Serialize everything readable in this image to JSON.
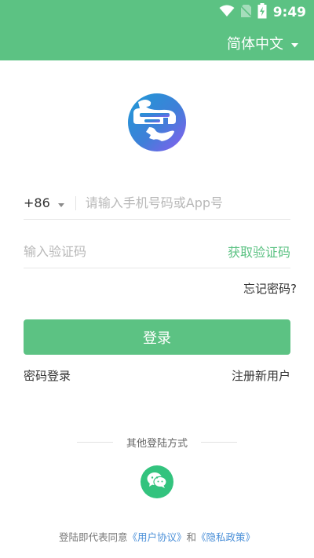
{
  "status_bar": {
    "time": "9:49",
    "icons": [
      "wifi-icon",
      "no-sim-icon",
      "battery-charging-icon"
    ]
  },
  "header": {
    "language_label": "简体中文",
    "dropdown_icon": "caret-down-icon",
    "background_color": "#5cc283"
  },
  "logo": {
    "icon": "app-logo-icon"
  },
  "phone": {
    "country_code": "+86",
    "placeholder": "请输入手机号码或App号",
    "value": ""
  },
  "code": {
    "placeholder": "输入验证码",
    "value": "",
    "get_code_label": "获取验证码"
  },
  "forgot_password": "忘记密码?",
  "login_button": "登录",
  "password_login": "密码登录",
  "register": "注册新用户",
  "other_login": {
    "title": "其他登陆方式",
    "methods": [
      {
        "icon": "wechat-icon"
      }
    ]
  },
  "agreement": {
    "prefix": "登陆即代表同意",
    "user_agreement": "《用户协议》",
    "conjunction": "和",
    "privacy_policy": "《隐私政策》"
  },
  "colors": {
    "accent": "#5cc283",
    "link": "#4a8fd8",
    "wechat": "#33c37e"
  }
}
